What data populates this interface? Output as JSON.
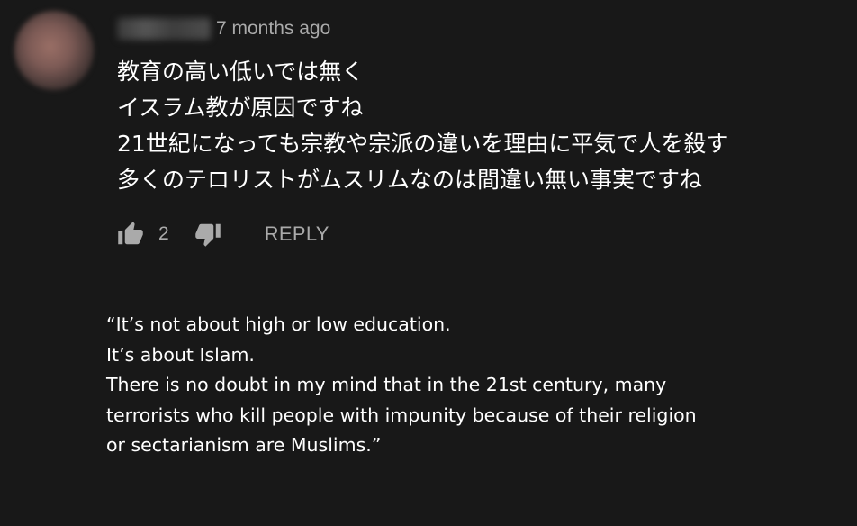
{
  "comment": {
    "timestamp": "7 months ago",
    "lines": [
      "教育の高い低いでは無く",
      "イスラム教が原因ですね",
      "21世紀になっても宗教や宗派の違いを理由に平気で人を殺す",
      "多くのテロリストがムスリムなのは間違い無い事実ですね"
    ],
    "like_count": "2",
    "reply_label": "REPLY"
  },
  "icons": {
    "like": "thumbs-up-icon",
    "dislike": "thumbs-down-icon"
  },
  "translation": {
    "lines": [
      "“It’s not about high or low education.",
      "It’s about Islam.",
      "There is no doubt in my mind that in the 21st century, many",
      "terrorists who kill people with impunity because of their religion",
      "or sectarianism are Muslims.”"
    ]
  },
  "colors": {
    "background": "#181818",
    "text": "#ffffff",
    "secondary_text": "#aaaaaa"
  }
}
